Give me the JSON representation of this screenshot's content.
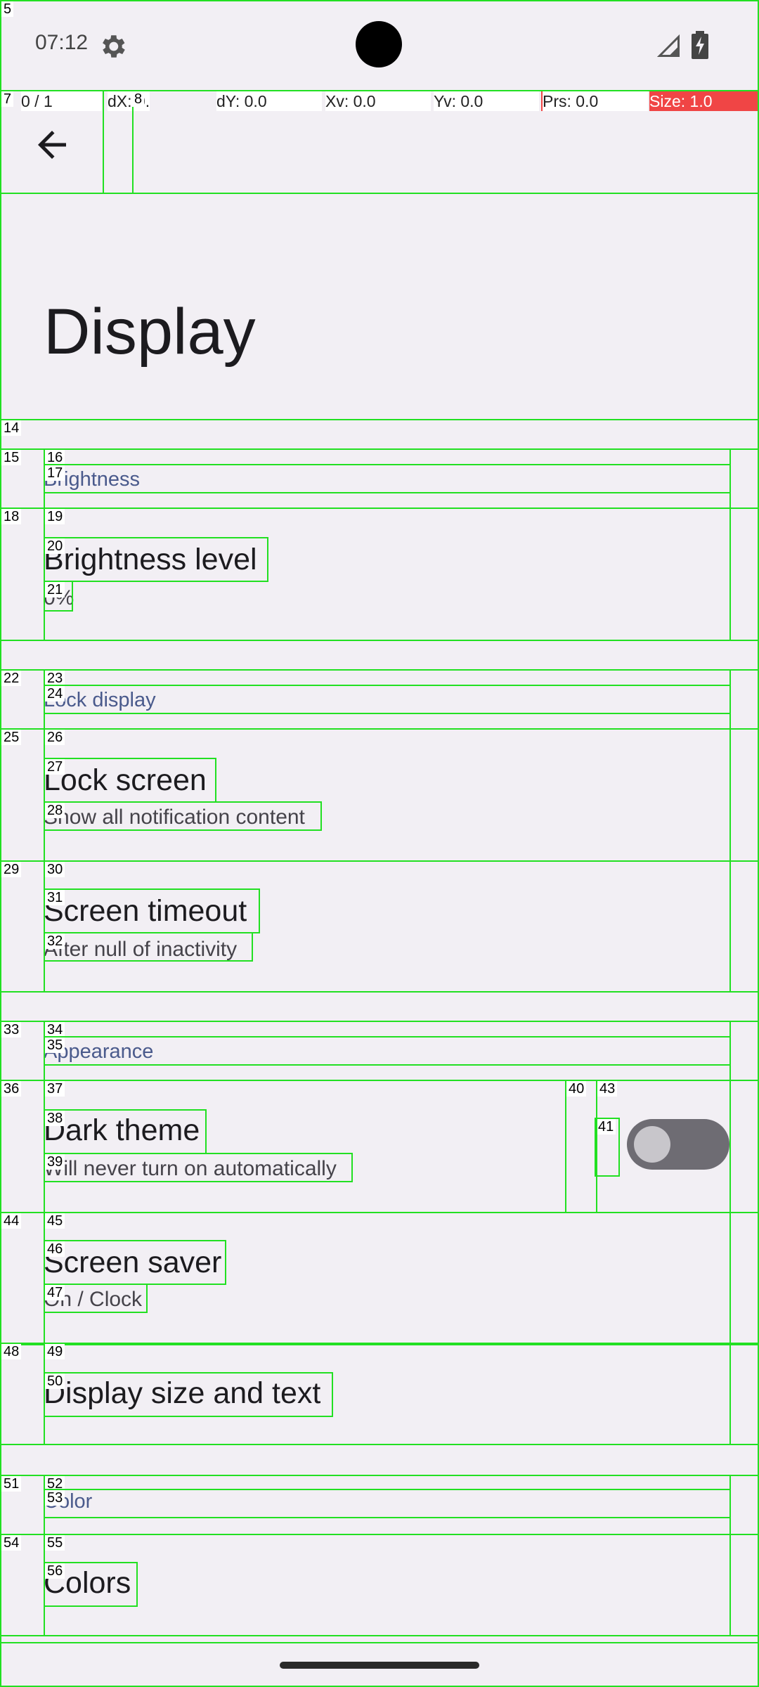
{
  "status_bar": {
    "time": "07:12"
  },
  "pointer_overlay": {
    "p": "0 / 1",
    "dx": "dX: 0.0",
    "dy": "dY: 0.0",
    "xv": "Xv: 0.0",
    "yv": "Yv: 0.0",
    "prs": "Prs: 0.0",
    "size": "Size: 1.0"
  },
  "header": {
    "title": "Display"
  },
  "sections": {
    "brightness": {
      "category": "Brightness",
      "level_title": "Brightness level",
      "level_summary": "0%"
    },
    "lock_display": {
      "category": "Lock display",
      "lock_screen_title": "Lock screen",
      "lock_screen_summary": "Show all notification content",
      "timeout_title": "Screen timeout",
      "timeout_summary": "After null of inactivity"
    },
    "appearance": {
      "category": "Appearance",
      "dark_theme_title": "Dark theme",
      "dark_theme_summary": "Will never turn on automatically",
      "dark_theme_enabled": false,
      "screen_saver_title": "Screen saver",
      "screen_saver_summary": "On / Clock",
      "display_size_title": "Display size and text"
    },
    "color": {
      "category": "Color",
      "colors_title": "Colors"
    }
  },
  "overlay_tags": [
    "5",
    "7",
    "8",
    "14",
    "15",
    "16",
    "17",
    "18",
    "19",
    "20",
    "21",
    "22",
    "23",
    "24",
    "25",
    "26",
    "27",
    "28",
    "29",
    "30",
    "31",
    "32",
    "33",
    "34",
    "35",
    "36",
    "37",
    "38",
    "39",
    "40",
    "41",
    "43",
    "44",
    "45",
    "46",
    "47",
    "48",
    "49",
    "50",
    "51",
    "52",
    "53",
    "54",
    "55",
    "56"
  ]
}
